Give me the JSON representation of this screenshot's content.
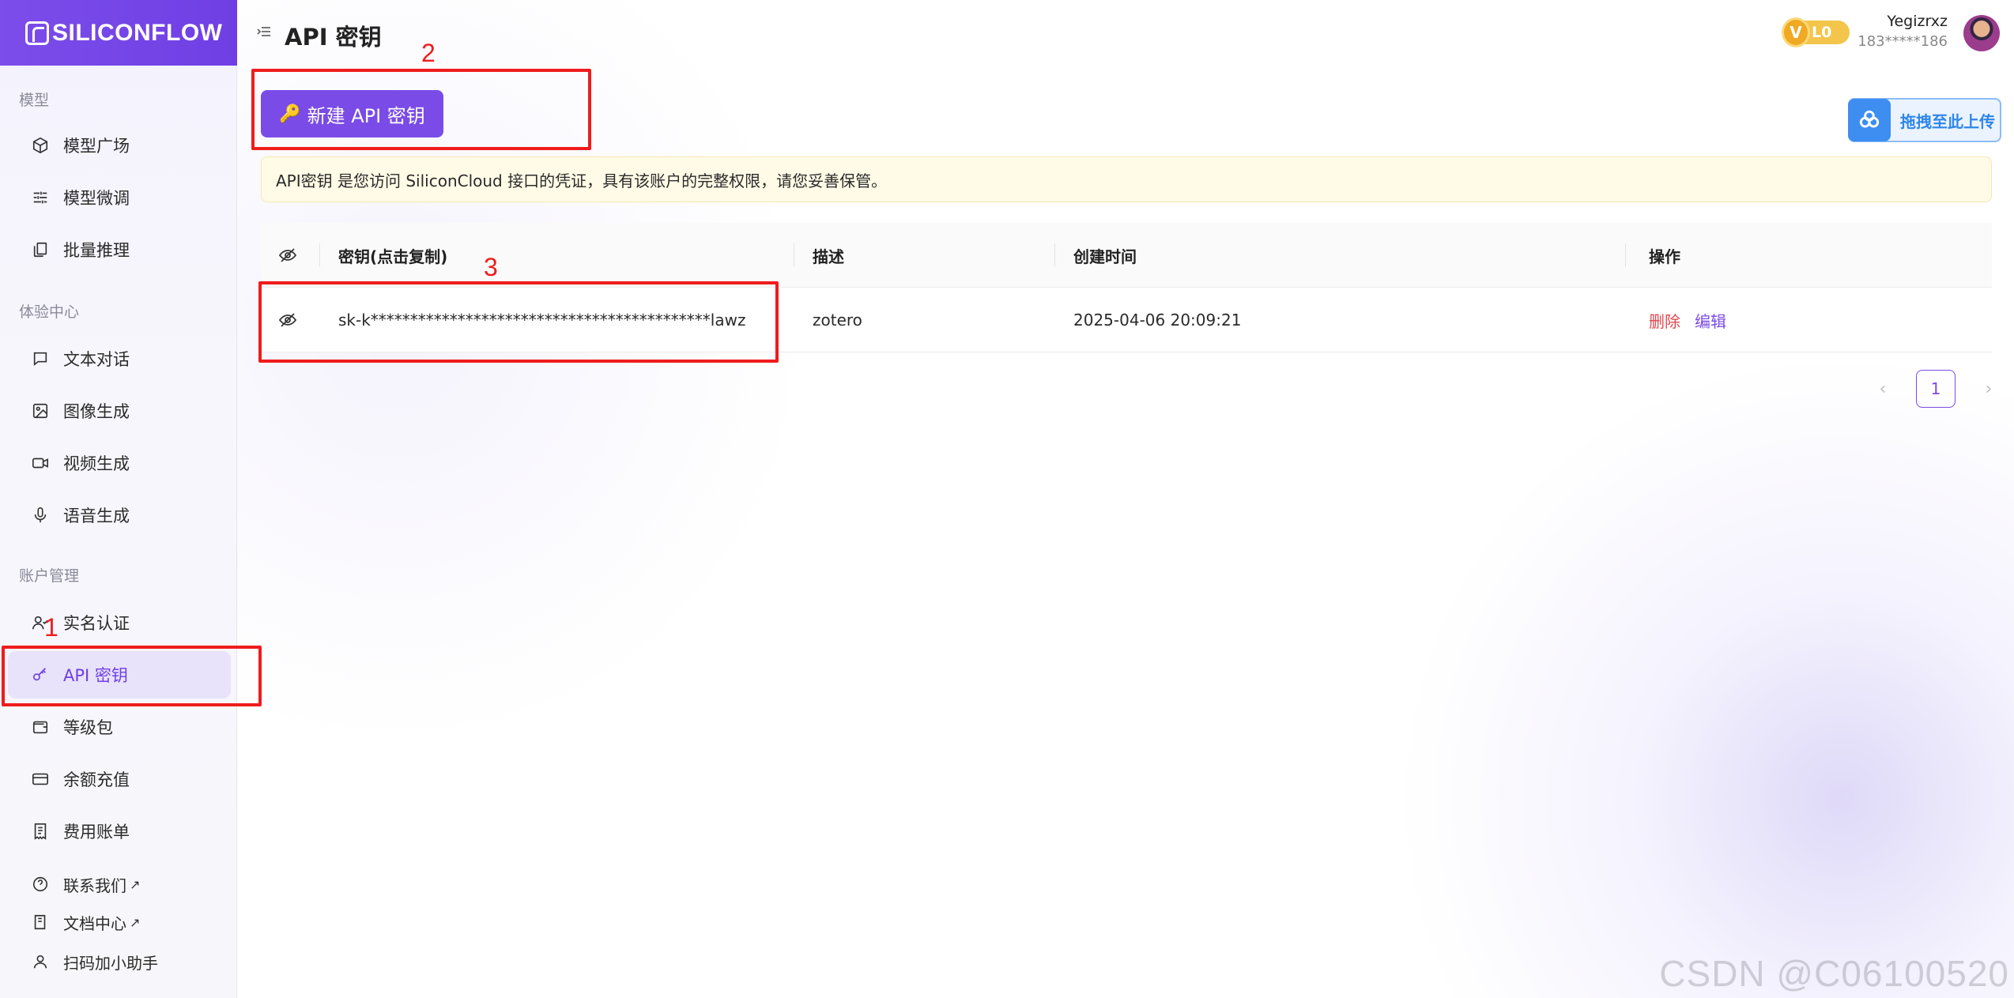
{
  "brand": {
    "logo_text": "SILICONFLOW"
  },
  "sidebar": {
    "sections": {
      "models": "模型",
      "experience": "体验中心",
      "account": "账户管理"
    },
    "items": [
      {
        "label": "模型广场",
        "icon": "cube-icon"
      },
      {
        "label": "模型微调",
        "icon": "sliders-icon"
      },
      {
        "label": "批量推理",
        "icon": "copy-stack-icon"
      },
      {
        "label": "文本对话",
        "icon": "chat-icon"
      },
      {
        "label": "图像生成",
        "icon": "image-icon"
      },
      {
        "label": "视频生成",
        "icon": "video-icon"
      },
      {
        "label": "语音生成",
        "icon": "mic-icon"
      },
      {
        "label": "实名认证",
        "icon": "user-check-icon"
      },
      {
        "label": "API 密钥",
        "icon": "key-icon",
        "active": true
      },
      {
        "label": "等级包",
        "icon": "wallet-icon"
      },
      {
        "label": "余额充值",
        "icon": "card-icon"
      },
      {
        "label": "费用账单",
        "icon": "receipt-icon"
      }
    ],
    "footer_items": [
      {
        "label": "联系我们",
        "icon": "help-circle-icon",
        "external": "↗"
      },
      {
        "label": "文档中心",
        "icon": "book-icon",
        "external": "↗"
      },
      {
        "label": "扫码加小助手",
        "icon": "user-icon"
      }
    ]
  },
  "header": {
    "title": "API 密钥",
    "vip_level": "L0",
    "vip_letter": "V",
    "user_name": "Yegizrxz",
    "user_phone": "183*****186"
  },
  "toolbar": {
    "new_key_label": "新建 API 密钥",
    "new_key_icon": "🔑",
    "upload_label": "拖拽至此上传"
  },
  "notice": "API密钥 是您访问 SiliconCloud 接口的凭证，具有该账户的完整权限，请您妥善保管。",
  "table": {
    "columns": [
      "密钥(点击复制)",
      "描述",
      "创建时间",
      "操作"
    ],
    "rows": [
      {
        "key": "sk-k*******************************************lawz",
        "description": "zotero",
        "created_at": "2025-04-06 20:09:21",
        "actions": {
          "delete": "删除",
          "edit": "编辑"
        }
      }
    ]
  },
  "pagination": {
    "prev": "‹",
    "current": "1",
    "next": "›"
  },
  "annotations": {
    "one": "1",
    "two": "2",
    "three": "3"
  },
  "colors": {
    "accent": "#7a4be6",
    "annotation": "#ef1c1c",
    "delete": "#e0474f"
  },
  "watermark": "CSDN @C06100520"
}
